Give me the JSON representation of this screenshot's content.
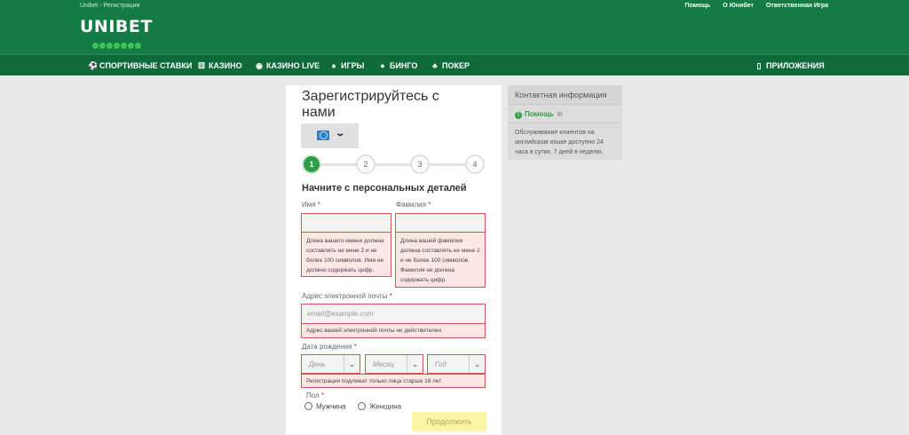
{
  "header": {
    "breadcrumb": "Unibet - Регистрация",
    "logo_text": "UNIBET",
    "links": [
      "Помощь",
      "О Юнибет",
      "Ответственная Игра"
    ]
  },
  "nav": {
    "items": [
      {
        "label": "СПОРТИВНЫЕ СТАВКИ",
        "icon": "soccer-ball-icon"
      },
      {
        "label": "КАЗИНО",
        "icon": "dice-icon"
      },
      {
        "label": "КАЗИНО LIVE",
        "icon": "live-chip-icon"
      },
      {
        "label": "ИГРЫ",
        "icon": "cards-icon"
      },
      {
        "label": "БИНГО",
        "icon": "bingo-ball-icon"
      },
      {
        "label": "ПОКЕР",
        "icon": "poker-card-icon"
      }
    ],
    "apps": {
      "label": "ПРИЛОЖЕНИЯ",
      "icon": "mobile-phone-icon"
    }
  },
  "form": {
    "title": "Зарегистрируйтесь с нами",
    "steps": [
      "1",
      "2",
      "3",
      "4"
    ],
    "active_step": 1,
    "section_title": "Начните с персональных деталей",
    "first_name": {
      "label": "Имя",
      "value": "",
      "error": "Длина вашего имени должна составлять не мене 2 и не более 100 символов. Имя не должно содержать цифр."
    },
    "last_name": {
      "label": "Фамилия",
      "value": "",
      "error": "Длина вашей фамилии должна составлять не мене 2 и не более 100 символов. Фамилия не должна содержать цифр."
    },
    "email": {
      "label": "Адрес электронной почты",
      "placeholder": "email@example.com",
      "error": "Адрес вашей электронной почты не действителен"
    },
    "dob": {
      "label": "Дата рождения",
      "day": "День",
      "month": "Месяц",
      "year": "Год",
      "error": "Регистрации подлежат только лица старше 18 лет"
    },
    "gender": {
      "label": "Пол",
      "options": [
        "Мужчина",
        "Женщина"
      ]
    },
    "continue_label": "Продолжить",
    "required_mark": "*"
  },
  "contact": {
    "title": "Контактная информация",
    "help_label": "Помощь",
    "description": "Обслуживание клиентов на английском языке доступно 24 часа в сутки, 7 дней в неделю."
  },
  "colors": {
    "brand_green": "#147b45",
    "nav_green": "#0f6a3a",
    "step_active": "#2e9e46",
    "error_border": "#d9534f",
    "error_bg": "#fde6e6",
    "continue_bg": "#fbf5a6"
  }
}
